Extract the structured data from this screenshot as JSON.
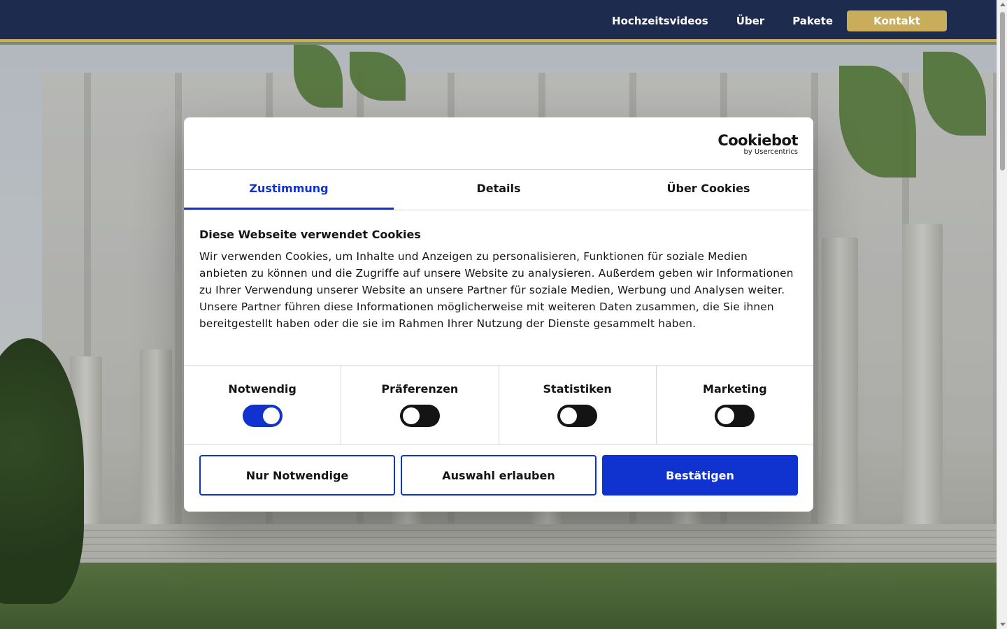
{
  "nav": {
    "items": [
      {
        "label": "Hochzeitsvideos"
      },
      {
        "label": "Über"
      },
      {
        "label": "Pakete"
      }
    ],
    "cta_label": "Kontakt"
  },
  "colors": {
    "header_bg": "#1d2b4f",
    "header_accent": "#c9ad5b",
    "dialog_accent": "#1032cf"
  },
  "dialog": {
    "logo": {
      "name": "Cookiebot",
      "sub": "by Usercentrics"
    },
    "tabs": [
      {
        "label": "Zustimmung",
        "active": true
      },
      {
        "label": "Details",
        "active": false
      },
      {
        "label": "Über Cookies",
        "active": false
      }
    ],
    "title": "Diese Webseite verwendet Cookies",
    "text": "Wir verwenden Cookies, um Inhalte und Anzeigen zu personalisieren, Funktionen für soziale Medien anbieten zu können und die Zugriffe auf unsere Website zu analysieren. Außerdem geben wir Informationen zu Ihrer Verwendung unserer Website an unsere Partner für soziale Medien, Werbung und Analysen weiter. Unsere Partner führen diese Informationen möglicherweise mit weiteren Daten zusammen, die Sie ihnen bereitgestellt haben oder die sie im Rahmen Ihrer Nutzung der Dienste gesammelt haben.",
    "toggles": [
      {
        "label": "Notwendig",
        "on": true
      },
      {
        "label": "Präferenzen",
        "on": false
      },
      {
        "label": "Statistiken",
        "on": false
      },
      {
        "label": "Marketing",
        "on": false
      }
    ],
    "buttons": {
      "necessary_only": "Nur Notwendige",
      "allow_selection": "Auswahl erlauben",
      "confirm": "Bestätigen"
    }
  }
}
